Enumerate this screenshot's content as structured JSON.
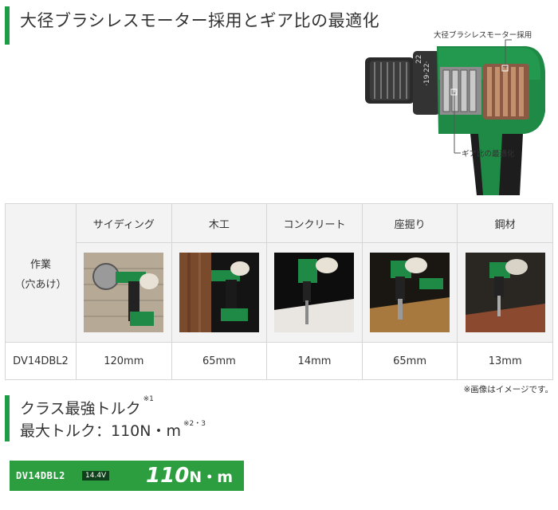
{
  "section1": {
    "title": "大径ブラシレスモーター採用とギア比の最適化",
    "callout_motor": "大径ブラシレスモーター採用",
    "callout_gear": "ギア比の最適化"
  },
  "table": {
    "row_label": [
      "作業",
      "（穴あけ）"
    ],
    "columns": [
      {
        "label": "サイディング",
        "icon": "siding-drilling-photo",
        "value": "120mm"
      },
      {
        "label": "木工",
        "icon": "wood-drilling-photo",
        "value": "65mm"
      },
      {
        "label": "コンクリート",
        "icon": "concrete-drilling-photo",
        "value": "14mm"
      },
      {
        "label": "座掘り",
        "icon": "counterbore-drilling-photo",
        "value": "65mm"
      },
      {
        "label": "鋼材",
        "icon": "steel-drilling-photo",
        "value": "13mm"
      }
    ],
    "model": "DV14DBL2"
  },
  "note": "※画像はイメージです。",
  "section2": {
    "line1": "クラス最強トルク",
    "line1_sup": "※1",
    "line2": "最大トルク：110N・m",
    "line2_sup": "※2・3"
  },
  "spec": {
    "model": "DV14DBL2",
    "voltage": "14.4V",
    "value": "110",
    "unit": "N・m"
  },
  "colors": {
    "accent_green": "#1f9d46",
    "spec_bar_green": "#2c9e40",
    "table_header_bg": "#f3f3f3"
  }
}
